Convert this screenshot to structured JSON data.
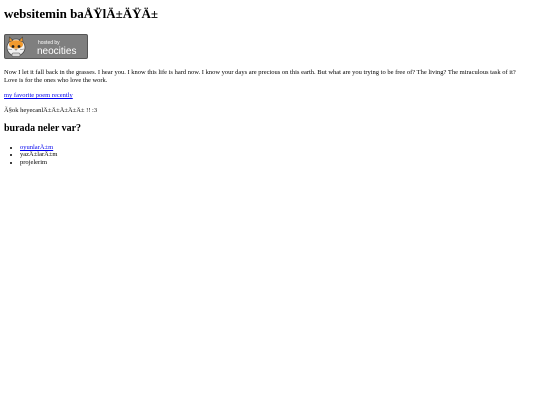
{
  "page": {
    "title": "websitemin baÅŸlÄ±ÄŸÄ±",
    "badge": {
      "line1": "hosted by",
      "line2": "neocities"
    },
    "paragraph": "Now I let it fall back in the grasses. I hear you. I know this life is hard now. I know your days are precious on this earth. But what are you trying to be free of? The living? The miraculous task of it? Love is for the ones who love the work.",
    "poem_link": "my favorite poem recently",
    "excited_line": "Ã§ok heyecanlÄ±Ä±Ä±Ä±Ä± !! :3",
    "section_heading": "burada neler var?",
    "list": [
      {
        "label": "oyunlarÄ±m",
        "is_link": true
      },
      {
        "label": "yazÄ±larÄ±m",
        "is_link": false
      },
      {
        "label": "projelerim",
        "is_link": false
      }
    ]
  },
  "colors": {
    "link": "#0000ee",
    "text": "#000000",
    "badge_bg": "#7f7f7f",
    "badge_text": "#ffffff"
  }
}
